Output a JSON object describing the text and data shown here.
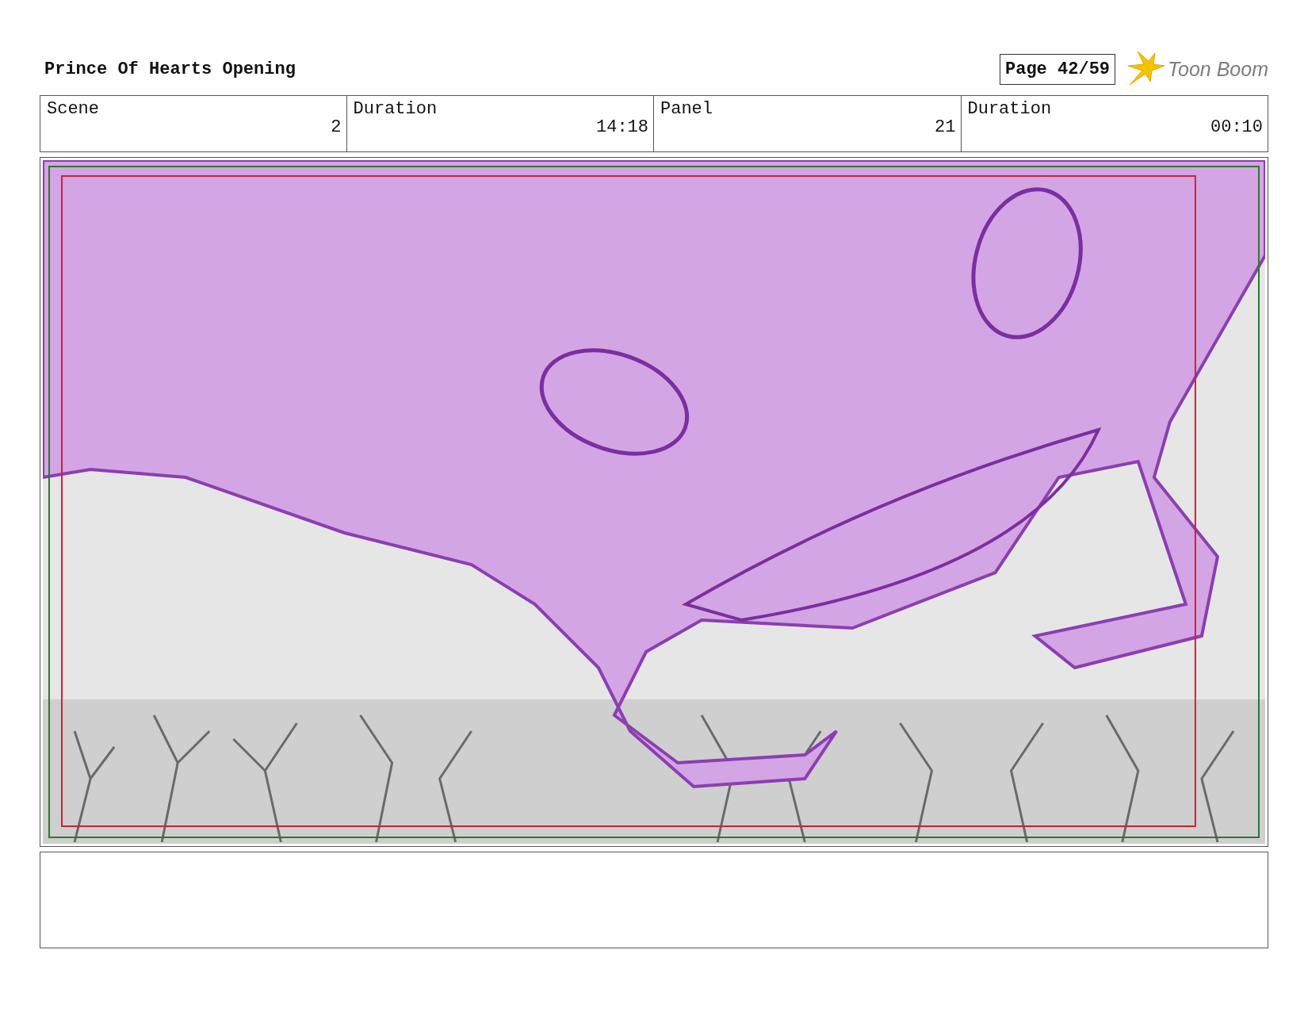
{
  "header": {
    "title": "Prince Of Hearts Opening",
    "page": "Page 42/59",
    "logo": "Toon Boom"
  },
  "info_table": {
    "columns": [
      "Scene",
      "Duration",
      "Panel",
      "Duration"
    ],
    "values": [
      "2",
      "14:18",
      "21",
      "00:10"
    ]
  }
}
